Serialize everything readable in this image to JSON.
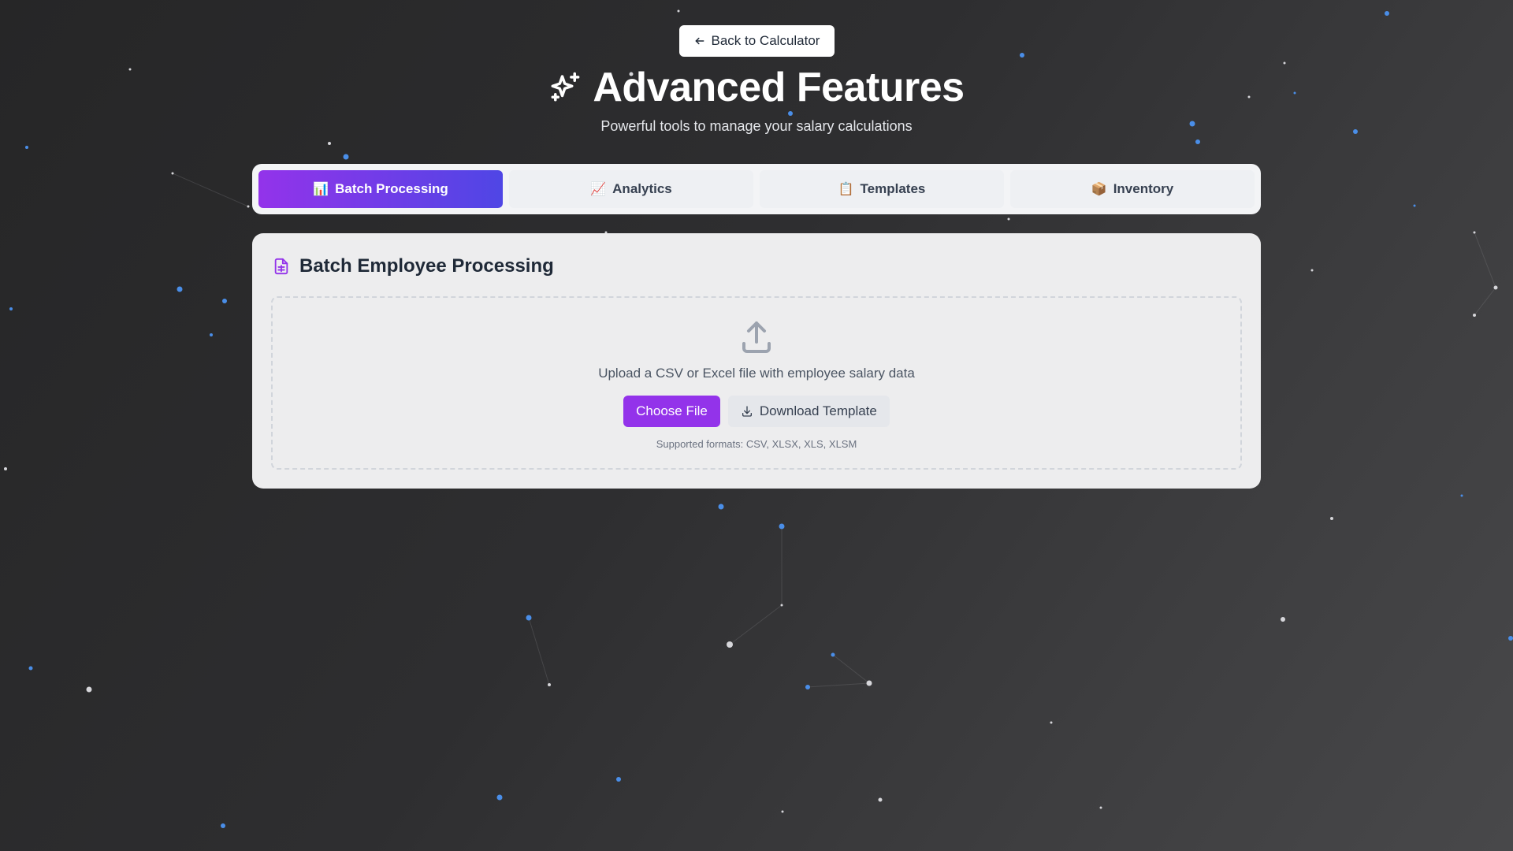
{
  "header": {
    "back_label": "Back to Calculator",
    "title": "Advanced Features",
    "subtitle": "Powerful tools to manage your salary calculations"
  },
  "tabs": [
    {
      "icon": "📊",
      "label": "Batch Processing",
      "active": true
    },
    {
      "icon": "📈",
      "label": "Analytics",
      "active": false
    },
    {
      "icon": "📋",
      "label": "Templates",
      "active": false
    },
    {
      "icon": "📦",
      "label": "Inventory",
      "active": false
    }
  ],
  "batch": {
    "title": "Batch Employee Processing",
    "upload_text": "Upload a CSV or Excel file with employee salary data",
    "choose_label": "Choose File",
    "download_label": "Download Template",
    "formats": "Supported formats: CSV, XLSX, XLS, XLSM"
  },
  "colors": {
    "accent": "#9333ea",
    "accent_end": "#4f46e5",
    "star_blue": "#3b82f6"
  },
  "icons": {
    "back": "arrow-left-icon",
    "title": "sparkles-icon",
    "card": "file-text-icon",
    "upload": "upload-icon",
    "download": "download-icon"
  }
}
